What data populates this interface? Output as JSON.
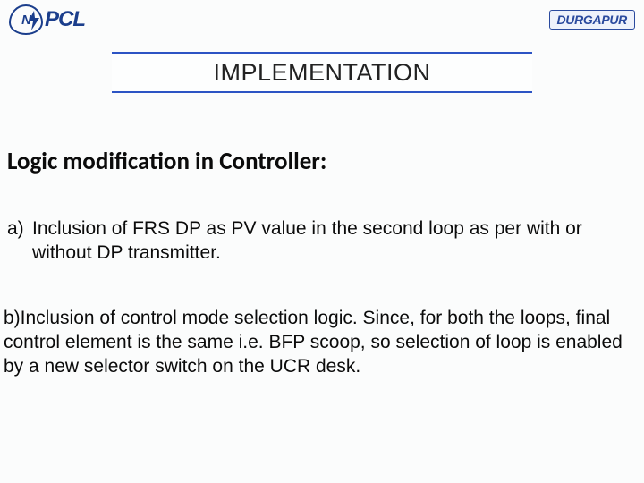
{
  "header": {
    "logo_left_mark": "N",
    "logo_left_text": "PCL",
    "logo_right": "DURGAPUR"
  },
  "title": "IMPLEMENTATION",
  "section_heading": "Logic modification in Controller:",
  "item_a": {
    "marker": "a)",
    "text": "Inclusion of FRS DP as PV value in the second loop as per with or without DP transmitter."
  },
  "item_b": {
    "text": "b)Inclusion of control mode selection logic. Since, for both the loops, final control element is the same i.e. BFP scoop, so selection of loop is enabled by a new selector switch on the UCR desk."
  }
}
